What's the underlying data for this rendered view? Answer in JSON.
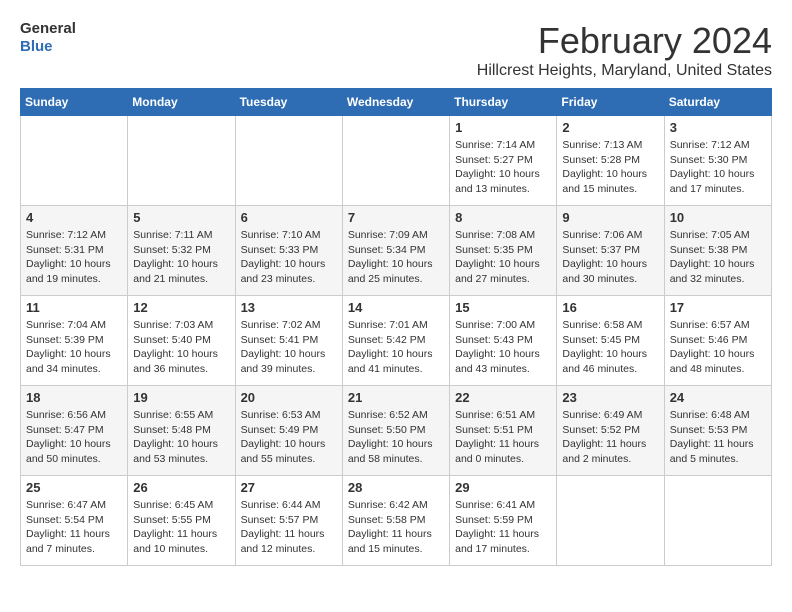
{
  "logo": {
    "line1": "General",
    "line2": "Blue"
  },
  "title": "February 2024",
  "subtitle": "Hillcrest Heights, Maryland, United States",
  "headers": [
    "Sunday",
    "Monday",
    "Tuesday",
    "Wednesday",
    "Thursday",
    "Friday",
    "Saturday"
  ],
  "weeks": [
    [
      {
        "day": "",
        "info": ""
      },
      {
        "day": "",
        "info": ""
      },
      {
        "day": "",
        "info": ""
      },
      {
        "day": "",
        "info": ""
      },
      {
        "day": "1",
        "info": "Sunrise: 7:14 AM\nSunset: 5:27 PM\nDaylight: 10 hours\nand 13 minutes."
      },
      {
        "day": "2",
        "info": "Sunrise: 7:13 AM\nSunset: 5:28 PM\nDaylight: 10 hours\nand 15 minutes."
      },
      {
        "day": "3",
        "info": "Sunrise: 7:12 AM\nSunset: 5:30 PM\nDaylight: 10 hours\nand 17 minutes."
      }
    ],
    [
      {
        "day": "4",
        "info": "Sunrise: 7:12 AM\nSunset: 5:31 PM\nDaylight: 10 hours\nand 19 minutes."
      },
      {
        "day": "5",
        "info": "Sunrise: 7:11 AM\nSunset: 5:32 PM\nDaylight: 10 hours\nand 21 minutes."
      },
      {
        "day": "6",
        "info": "Sunrise: 7:10 AM\nSunset: 5:33 PM\nDaylight: 10 hours\nand 23 minutes."
      },
      {
        "day": "7",
        "info": "Sunrise: 7:09 AM\nSunset: 5:34 PM\nDaylight: 10 hours\nand 25 minutes."
      },
      {
        "day": "8",
        "info": "Sunrise: 7:08 AM\nSunset: 5:35 PM\nDaylight: 10 hours\nand 27 minutes."
      },
      {
        "day": "9",
        "info": "Sunrise: 7:06 AM\nSunset: 5:37 PM\nDaylight: 10 hours\nand 30 minutes."
      },
      {
        "day": "10",
        "info": "Sunrise: 7:05 AM\nSunset: 5:38 PM\nDaylight: 10 hours\nand 32 minutes."
      }
    ],
    [
      {
        "day": "11",
        "info": "Sunrise: 7:04 AM\nSunset: 5:39 PM\nDaylight: 10 hours\nand 34 minutes."
      },
      {
        "day": "12",
        "info": "Sunrise: 7:03 AM\nSunset: 5:40 PM\nDaylight: 10 hours\nand 36 minutes."
      },
      {
        "day": "13",
        "info": "Sunrise: 7:02 AM\nSunset: 5:41 PM\nDaylight: 10 hours\nand 39 minutes."
      },
      {
        "day": "14",
        "info": "Sunrise: 7:01 AM\nSunset: 5:42 PM\nDaylight: 10 hours\nand 41 minutes."
      },
      {
        "day": "15",
        "info": "Sunrise: 7:00 AM\nSunset: 5:43 PM\nDaylight: 10 hours\nand 43 minutes."
      },
      {
        "day": "16",
        "info": "Sunrise: 6:58 AM\nSunset: 5:45 PM\nDaylight: 10 hours\nand 46 minutes."
      },
      {
        "day": "17",
        "info": "Sunrise: 6:57 AM\nSunset: 5:46 PM\nDaylight: 10 hours\nand 48 minutes."
      }
    ],
    [
      {
        "day": "18",
        "info": "Sunrise: 6:56 AM\nSunset: 5:47 PM\nDaylight: 10 hours\nand 50 minutes."
      },
      {
        "day": "19",
        "info": "Sunrise: 6:55 AM\nSunset: 5:48 PM\nDaylight: 10 hours\nand 53 minutes."
      },
      {
        "day": "20",
        "info": "Sunrise: 6:53 AM\nSunset: 5:49 PM\nDaylight: 10 hours\nand 55 minutes."
      },
      {
        "day": "21",
        "info": "Sunrise: 6:52 AM\nSunset: 5:50 PM\nDaylight: 10 hours\nand 58 minutes."
      },
      {
        "day": "22",
        "info": "Sunrise: 6:51 AM\nSunset: 5:51 PM\nDaylight: 11 hours\nand 0 minutes."
      },
      {
        "day": "23",
        "info": "Sunrise: 6:49 AM\nSunset: 5:52 PM\nDaylight: 11 hours\nand 2 minutes."
      },
      {
        "day": "24",
        "info": "Sunrise: 6:48 AM\nSunset: 5:53 PM\nDaylight: 11 hours\nand 5 minutes."
      }
    ],
    [
      {
        "day": "25",
        "info": "Sunrise: 6:47 AM\nSunset: 5:54 PM\nDaylight: 11 hours\nand 7 minutes."
      },
      {
        "day": "26",
        "info": "Sunrise: 6:45 AM\nSunset: 5:55 PM\nDaylight: 11 hours\nand 10 minutes."
      },
      {
        "day": "27",
        "info": "Sunrise: 6:44 AM\nSunset: 5:57 PM\nDaylight: 11 hours\nand 12 minutes."
      },
      {
        "day": "28",
        "info": "Sunrise: 6:42 AM\nSunset: 5:58 PM\nDaylight: 11 hours\nand 15 minutes."
      },
      {
        "day": "29",
        "info": "Sunrise: 6:41 AM\nSunset: 5:59 PM\nDaylight: 11 hours\nand 17 minutes."
      },
      {
        "day": "",
        "info": ""
      },
      {
        "day": "",
        "info": ""
      }
    ]
  ]
}
